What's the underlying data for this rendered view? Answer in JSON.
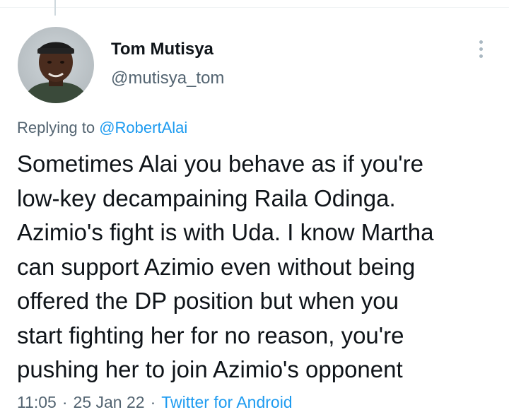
{
  "tweet": {
    "author": {
      "display_name": "Tom Mutisya",
      "handle": "@mutisya_tom",
      "avatar_icon": "profile-photo-icon"
    },
    "reply_prefix": "Replying to",
    "reply_to": "@RobertAlai",
    "text_lines": [
      "Sometimes Alai you behave as if you're",
      "low-key decampaining Raila Odinga.",
      "Azimio's fight is with Uda. I know Martha",
      "can support Azimio even without being",
      "offered the DP position but when you",
      "start fighting her for no reason, you're",
      "pushing her to join Azimio's opponent"
    ],
    "time": "11:05",
    "separator": "·",
    "date": "25 Jan 22",
    "source": "Twitter for Android"
  },
  "colors": {
    "text": "#0f1419",
    "secondary": "#536471",
    "link": "#1d9bf0",
    "border": "#eff3f4"
  }
}
